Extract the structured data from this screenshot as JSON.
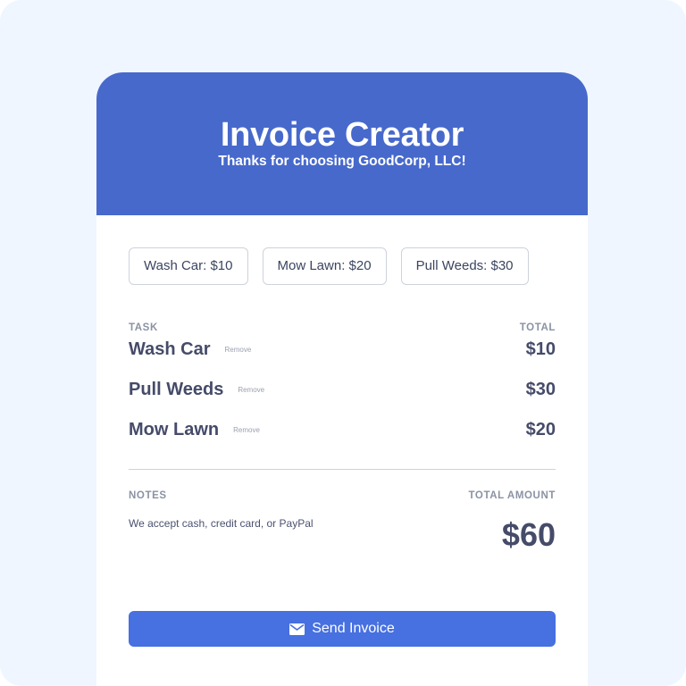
{
  "header": {
    "title": "Invoice Creator",
    "subtitle": "Thanks for choosing GoodCorp, LLC!"
  },
  "task_buttons": [
    {
      "label": "Wash Car: $10"
    },
    {
      "label": "Mow Lawn: $20"
    },
    {
      "label": "Pull Weeds: $30"
    }
  ],
  "table": {
    "task_header": "TASK",
    "total_header": "TOTAL",
    "remove_label": "Remove",
    "rows": [
      {
        "task": "Wash Car",
        "price": "$10"
      },
      {
        "task": "Pull Weeds",
        "price": "$30"
      },
      {
        "task": "Mow Lawn",
        "price": "$20"
      }
    ]
  },
  "footer": {
    "notes_header": "NOTES",
    "total_amount_header": "TOTAL AMOUNT",
    "notes_text": "We accept cash, credit card, or PayPal",
    "total_amount": "$60"
  },
  "send_button": {
    "label": "Send Invoice",
    "icon": "envelope-icon"
  },
  "colors": {
    "page_background": "#eff6ff",
    "header_background": "#4769cc",
    "button_accent": "#4770e0",
    "text_dark": "#454b69"
  }
}
